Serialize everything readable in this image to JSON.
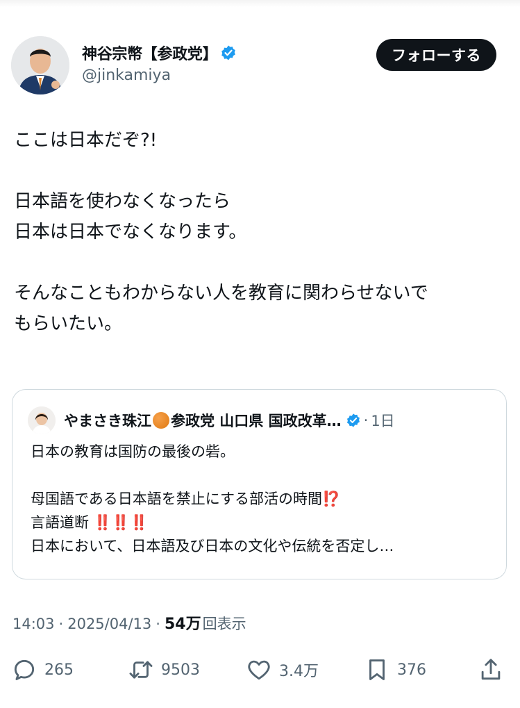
{
  "author": {
    "display_name": "神谷宗幣【参政党】",
    "handle": "@jinkamiya",
    "follow_label": "フォローする",
    "verified_color": "#1d9bf0"
  },
  "tweet": {
    "lines": [
      "ここは日本だぞ?!",
      "",
      "日本語を使わなくなったら",
      "日本は日本でなくなります。",
      "",
      "そんなこともわからない人を教育に関わらせないで",
      "もらいたい。"
    ]
  },
  "quote": {
    "name_part1": "やまさき珠江",
    "name_part2": "参政党 山口県 国政改革…",
    "dot": "·",
    "time": "1日",
    "line1": "日本の教育は国防の最後の砦。",
    "line2": "母国語である日本語を禁止にする部活の時間",
    "line2_mark": "⁉️",
    "line3": "言語道断",
    "line3_mark": "‼️‼️‼️",
    "line4": "日本において、日本語及び日本の文化や伝統を否定し…"
  },
  "meta": {
    "time": "14:03",
    "sep": "·",
    "date": "2025/04/13",
    "views": "54万",
    "views_label": "回表示"
  },
  "actions": {
    "replies": "265",
    "retweets": "9503",
    "likes": "3.4万",
    "bookmarks": "376"
  }
}
